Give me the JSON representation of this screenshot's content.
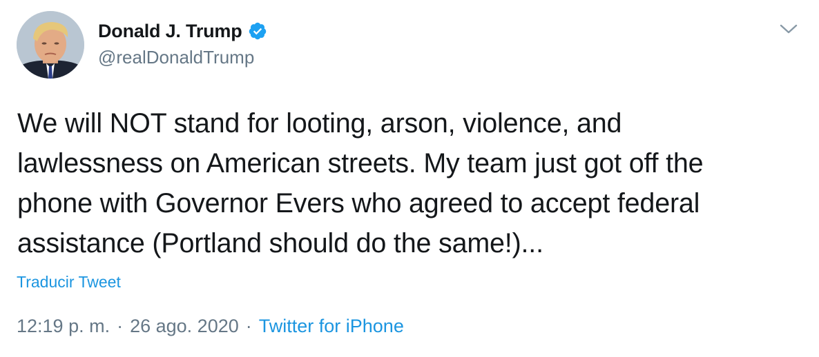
{
  "author": {
    "display_name": "Donald J. Trump",
    "handle": "@realDonaldTrump",
    "verified": true
  },
  "tweet": {
    "text": "We will NOT stand for looting, arson, violence, and\nlawlessness on American streets. My team just got off the\nphone with Governor Evers who agreed to accept federal\nassistance (Portland should do the same!)...",
    "translate_label": "Traducir Tweet"
  },
  "meta": {
    "time": "12:19 p. m.",
    "date": "26 ago. 2020",
    "separator": "·",
    "source": "Twitter for iPhone"
  },
  "icons": {
    "verified": "verified-badge-icon",
    "menu": "chevron-down-icon"
  },
  "colors": {
    "link": "#1b95e0",
    "secondary_text": "#657786",
    "primary_text": "#14171a",
    "verified": "#1da1f2"
  }
}
